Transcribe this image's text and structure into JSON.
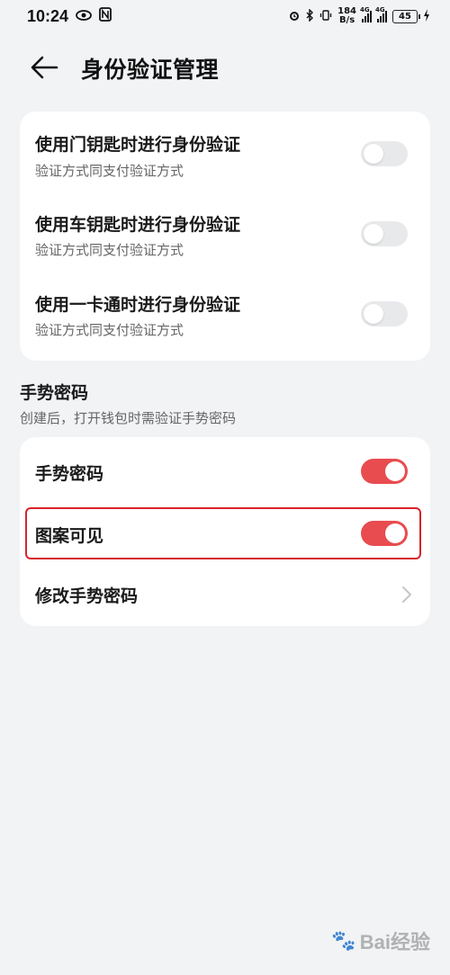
{
  "status_bar": {
    "time": "10:24",
    "net_speed_value": "184",
    "net_speed_unit": "B/s",
    "signal1_tag": "4G",
    "signal2_tag": "4G",
    "battery": "45",
    "icons": [
      "eye-icon",
      "nfc-icon",
      "alarm-icon",
      "bluetooth-icon",
      "vibrate-icon",
      "signal-icon",
      "battery-icon",
      "charging-icon"
    ]
  },
  "header": {
    "title": "身份验证管理"
  },
  "auth_card": {
    "items": [
      {
        "title": "使用门钥匙时进行身份验证",
        "subtitle": "验证方式同支付验证方式",
        "enabled": false
      },
      {
        "title": "使用车钥匙时进行身份验证",
        "subtitle": "验证方式同支付验证方式",
        "enabled": false
      },
      {
        "title": "使用一卡通时进行身份验证",
        "subtitle": "验证方式同支付验证方式",
        "enabled": false
      }
    ]
  },
  "gesture_section": {
    "title": "手势密码",
    "description": "创建后，打开钱包时需验证手势密码"
  },
  "gesture_card": {
    "items": [
      {
        "title": "手势密码",
        "enabled": true
      },
      {
        "title": "图案可见",
        "enabled": true
      },
      {
        "title": "修改手势密码"
      }
    ]
  },
  "colors": {
    "accent": "#e84c4f",
    "highlight": "#d8232a",
    "background": "#f1f3f5"
  },
  "watermark": {
    "text": "Bai经验"
  }
}
